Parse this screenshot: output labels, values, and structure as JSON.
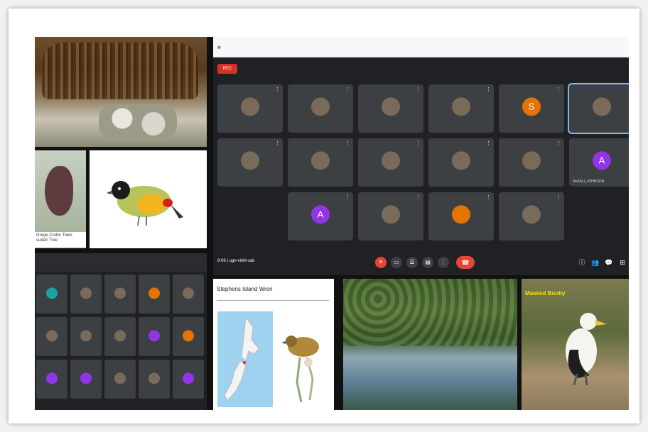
{
  "colors": {
    "meet_bg": "#202124",
    "tile_bg": "#3c4043",
    "accent_red": "#ea4335",
    "active_outline": "#8ab4f8"
  },
  "left_panel": {
    "bird_caption": "Gorge Crofer Town sudan Tree"
  },
  "left_grid": {
    "tiles": [
      {
        "initial": "",
        "name": "",
        "color": "#1aa3a3"
      },
      {
        "initial": "",
        "name": "",
        "color": "#3c4043"
      },
      {
        "initial": "",
        "name": "",
        "color": "#3c4043"
      },
      {
        "initial": "",
        "name": "",
        "color": "#e37400"
      },
      {
        "initial": "",
        "name": "",
        "color": "#3c4043"
      },
      {
        "initial": "",
        "name": "",
        "color": "#3c4043"
      },
      {
        "initial": "",
        "name": "",
        "color": "#3c4043"
      },
      {
        "initial": "",
        "name": "",
        "color": "#3c4043"
      },
      {
        "initial": "",
        "name": "",
        "color": "#9334e6"
      },
      {
        "initial": "",
        "name": "",
        "color": "#e37400"
      },
      {
        "initial": "",
        "name": "",
        "color": "#9334e6"
      },
      {
        "initial": "",
        "name": "",
        "color": "#9334e6"
      },
      {
        "initial": "",
        "name": "",
        "color": "#3c4043"
      },
      {
        "initial": "",
        "name": "",
        "color": "#3c4043"
      },
      {
        "initial": "",
        "name": "",
        "color": "#9334e6"
      },
      {
        "initial": "",
        "name": "",
        "color": "#3c4043"
      },
      {
        "initial": "",
        "name": "",
        "color": "#3c4043"
      }
    ]
  },
  "meet": {
    "rec_label": "REC",
    "time_label": "8:06  |  ugn-vinkt-sak",
    "tiles": [
      {
        "initial": "",
        "name": "",
        "color": "#3c4043"
      },
      {
        "initial": "",
        "name": "",
        "color": "#3c4043"
      },
      {
        "initial": "",
        "name": "",
        "color": "#3c4043"
      },
      {
        "initial": "",
        "name": "",
        "color": "#3c4043"
      },
      {
        "initial": "S",
        "name": "",
        "color": "#e37400"
      },
      {
        "initial": "",
        "name": "",
        "color": "#3c4043"
      },
      {
        "initial": "",
        "name": "",
        "color": "#3c4043"
      },
      {
        "initial": "",
        "name": "",
        "color": "#3c4043"
      },
      {
        "initial": "",
        "name": "",
        "color": "#3c4043"
      },
      {
        "initial": "",
        "name": "",
        "color": "#3c4043"
      },
      {
        "initial": "",
        "name": "",
        "color": "#3c4043"
      },
      {
        "initial": "A",
        "name": "ANJALI_JOHNSON",
        "color": "#9334e6"
      },
      {
        "initial": "A",
        "name": "",
        "color": "#9334e6"
      },
      {
        "initial": "",
        "name": "",
        "color": "#3c4043"
      },
      {
        "initial": "",
        "name": "",
        "color": "#e37400"
      },
      {
        "initial": "",
        "name": "",
        "color": "#3c4043"
      }
    ]
  },
  "map_card": {
    "title": "Stephens Island Wren"
  },
  "booby_photo": {
    "label": "Masked Booby"
  }
}
